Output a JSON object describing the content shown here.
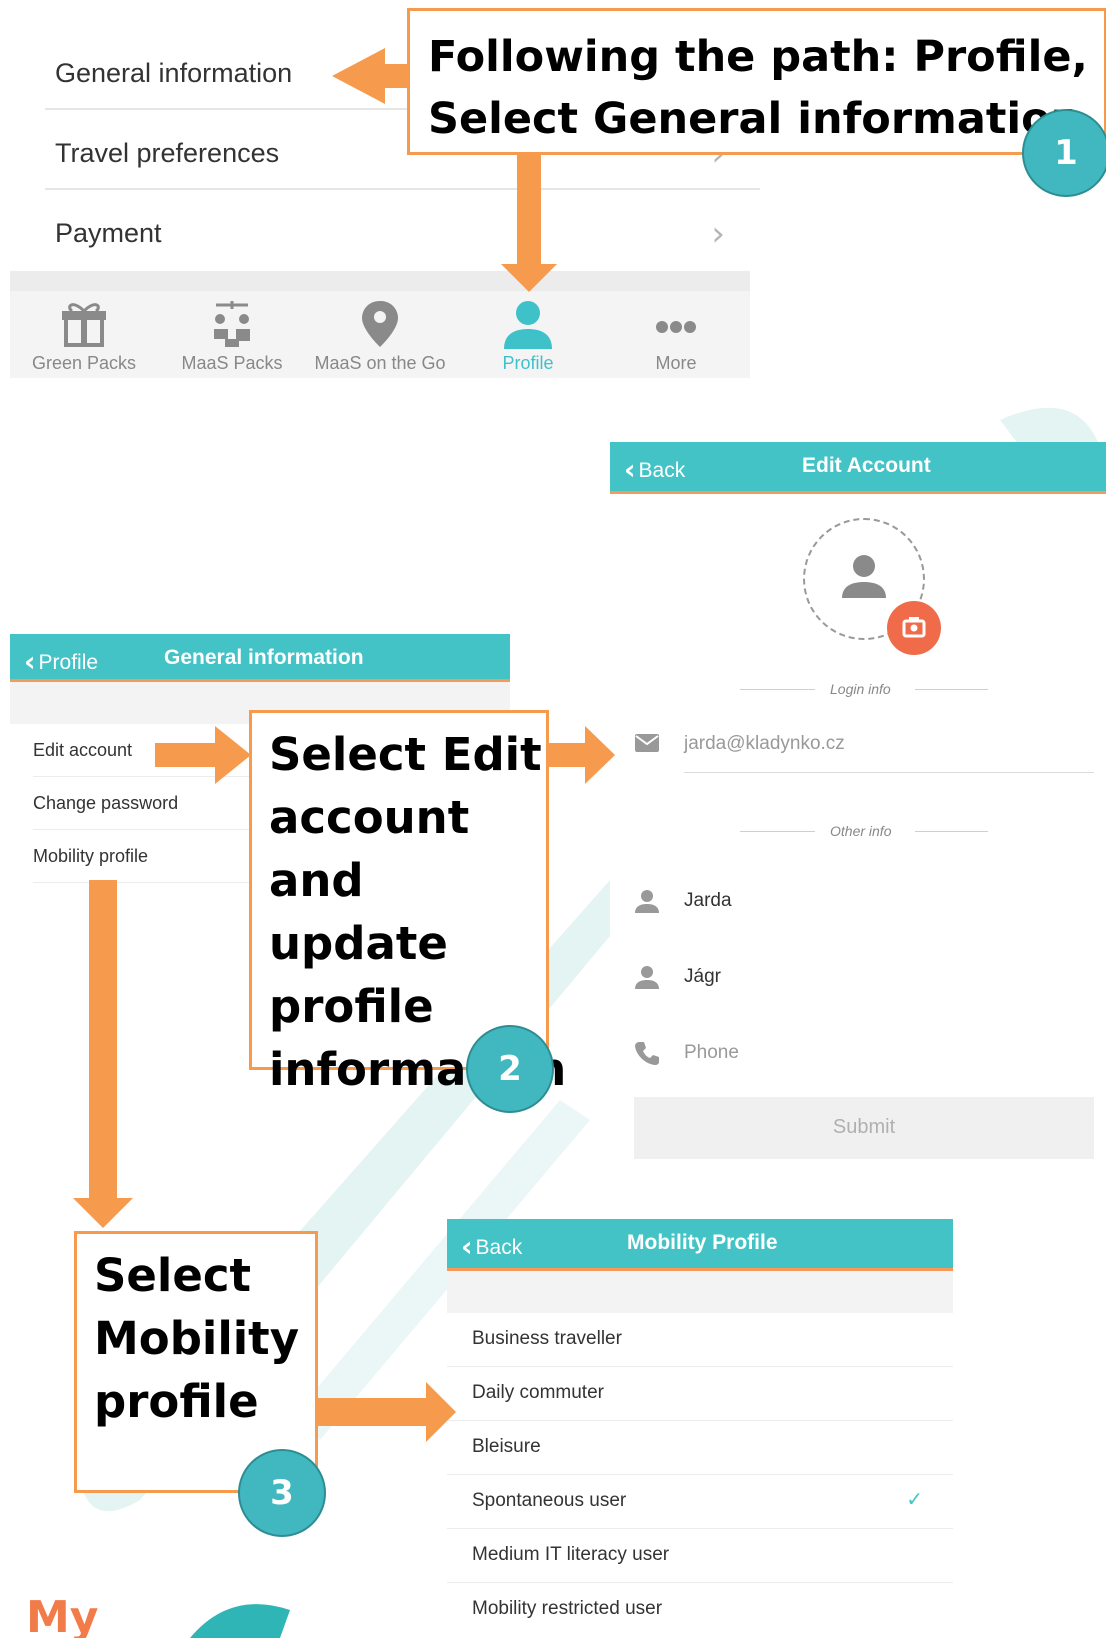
{
  "panel1": {
    "rows": [
      {
        "label": "General information"
      },
      {
        "label": "Travel preferences"
      },
      {
        "label": "Payment"
      }
    ],
    "chevron": "›",
    "tabs": [
      {
        "label": "Green Packs",
        "icon": "gift-icon"
      },
      {
        "label": "MaaS Packs",
        "icon": "transport-modes-icon"
      },
      {
        "label": "MaaS on the Go",
        "icon": "map-pin-icon"
      },
      {
        "label": "Profile",
        "icon": "user-icon",
        "active": true
      },
      {
        "label": "More",
        "icon": "more-dots-icon"
      }
    ]
  },
  "general_info": {
    "back_label": "Profile",
    "title": "General information",
    "rows": [
      {
        "label": "Edit account"
      },
      {
        "label": "Change password"
      },
      {
        "label": "Mobility profile"
      }
    ]
  },
  "edit_account": {
    "back_label": "Back",
    "title": "Edit Account",
    "login_info_label": "Login info",
    "email_value": "jarda@kladynko.cz",
    "other_info_label": "Other info",
    "first_name": "Jarda",
    "last_name": "Jágr",
    "phone_placeholder": "Phone",
    "submit_label": "Submit"
  },
  "mobility_profile": {
    "back_label": "Back",
    "title": "Mobility Profile",
    "rows": [
      {
        "label": "Business traveller",
        "checked": false
      },
      {
        "label": "Daily commuter",
        "checked": false
      },
      {
        "label": "Bleisure",
        "checked": false
      },
      {
        "label": "Spontaneous user",
        "checked": true
      },
      {
        "label": "Medium IT literacy user",
        "checked": false
      },
      {
        "label": "Mobility restricted user",
        "checked": false
      }
    ],
    "check_glyph": "✓"
  },
  "callouts": {
    "step1": {
      "lines": [
        "Following the path: Profile,",
        "Select General information"
      ],
      "badge": "1"
    },
    "step2": {
      "lines": [
        "Select Edit",
        "account",
        "and update",
        "profile",
        "information"
      ],
      "badge": "2"
    },
    "step3": {
      "lines": [
        "Select",
        "Mobility",
        "profile"
      ],
      "badge": "3"
    }
  },
  "logo_text": "My",
  "colors": {
    "accent": "#44c3c7",
    "arrow": "#f69a4d",
    "badge": "#41b8bf",
    "camera": "#f06b4a"
  }
}
